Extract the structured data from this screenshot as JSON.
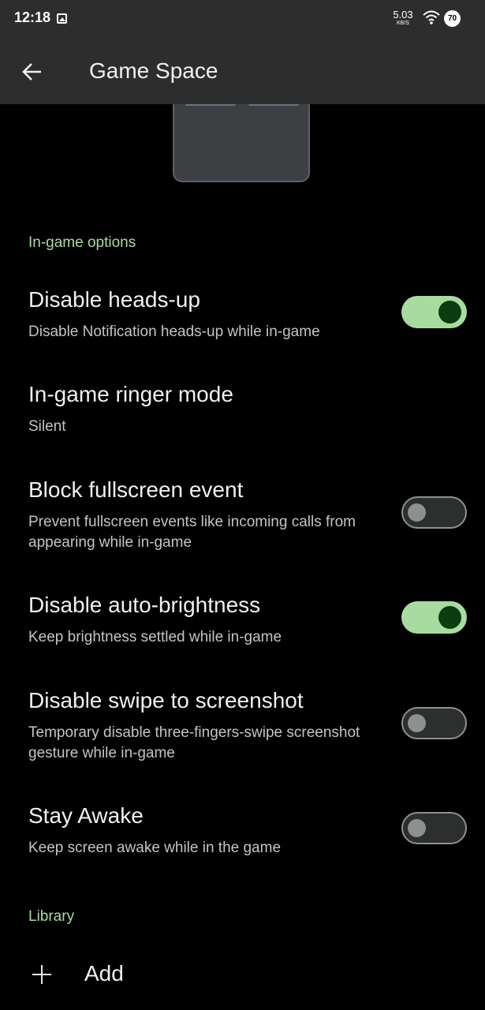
{
  "status_bar": {
    "time": "12:18",
    "net_speed": "5.03",
    "net_unit": "KB/S",
    "battery": "70"
  },
  "app_bar": {
    "title": "Game Space"
  },
  "sections": {
    "ingame_header": "In-game options",
    "library_header": "Library"
  },
  "options": [
    {
      "title": "Disable heads-up",
      "summary": "Disable Notification heads-up while in-game",
      "toggle": true
    },
    {
      "title": "In-game ringer mode",
      "summary": "Silent",
      "toggle": null
    },
    {
      "title": "Block fullscreen event",
      "summary": "Prevent fullscreen events like incoming calls from appearing while in-game",
      "toggle": false
    },
    {
      "title": "Disable auto-brightness",
      "summary": "Keep brightness settled while in-game",
      "toggle": true
    },
    {
      "title": "Disable swipe to screenshot",
      "summary": "Temporary disable three-fingers-swipe screenshot gesture while in-game",
      "toggle": false
    },
    {
      "title": "Stay Awake",
      "summary": "Keep screen awake while in the game",
      "toggle": false
    }
  ],
  "library": {
    "add_label": "Add"
  },
  "colors": {
    "accent": "#a8dba0",
    "toggle_knob_on": "#0b3d11",
    "appbar_bg": "#2d2d2d",
    "background": "#000000"
  }
}
